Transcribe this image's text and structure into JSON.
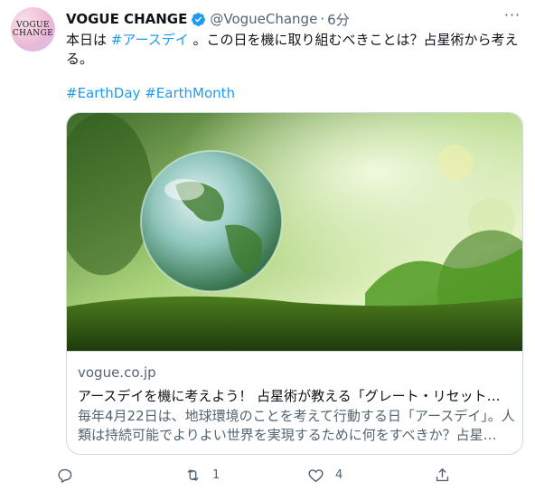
{
  "tweet": {
    "avatar_text": [
      "VOGUE",
      "CHANGE"
    ],
    "display_name": "VOGUE CHANGE",
    "handle": "@VogueChange",
    "separator": "·",
    "time": "6分",
    "text_before": "本日は ",
    "text_hashtag": "#アースデイ",
    "text_after": " 。この日を機に取り組むべきことは？占星術から考える。",
    "hashtag_1": "#EarthDay",
    "hashtag_2": "#EarthMonth"
  },
  "card": {
    "domain": "vogue.co.jp",
    "title": "アースデイを機に考えよう！ 占星術が教える「グレート・リセット」…",
    "description": "毎年4月22日は、地球環境のことを考えて行動する日「アースデイ」。人類は持続可能でよりよい世界を実現するために何をすべきか？占星…"
  },
  "actions": {
    "reply": {
      "icon": "reply-icon",
      "count": ""
    },
    "retweet": {
      "icon": "retweet-icon",
      "count": "1"
    },
    "like": {
      "icon": "heart-icon",
      "count": "4"
    },
    "share": {
      "icon": "share-icon",
      "count": ""
    }
  },
  "colors": {
    "link": "#1d9bf0",
    "verified": "#1d9bf0",
    "secondary_text": "#536471",
    "border": "#cfd9de"
  }
}
